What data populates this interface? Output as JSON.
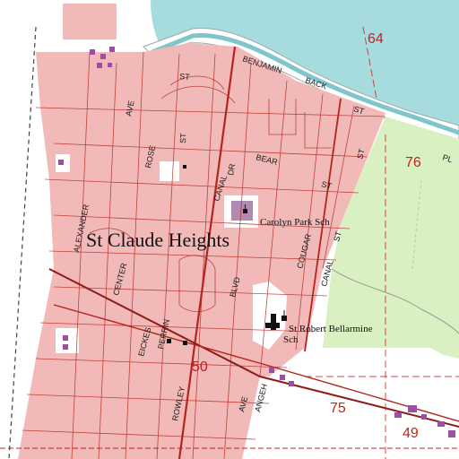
{
  "map": {
    "place_name": "St Claude Heights",
    "schools": [
      "Carolyn Park Sch",
      "St Robert Bellarmine",
      "Sch"
    ],
    "streets": [
      "BENJAMIN",
      "BACK",
      "ST",
      "ST",
      "ST",
      "BEAR",
      "ST",
      "DR",
      "CANAL",
      "ST",
      "ROSE",
      "AVE",
      "ALEXANDER",
      "CENTER",
      "EICKES",
      "PERRIN",
      "ROWLEY",
      "BLVD",
      "CANAL",
      "COUGAR",
      "ST",
      "AVE",
      "ANGEH",
      "PL"
    ],
    "sections": [
      "64",
      "76",
      "50",
      "75",
      "49"
    ],
    "colors": {
      "water": "#a7dcdf",
      "urban": "#f2b9b9",
      "wetland": "#d9f0c2",
      "street_line": "#b5231c",
      "section_text": "#c8201c"
    }
  }
}
